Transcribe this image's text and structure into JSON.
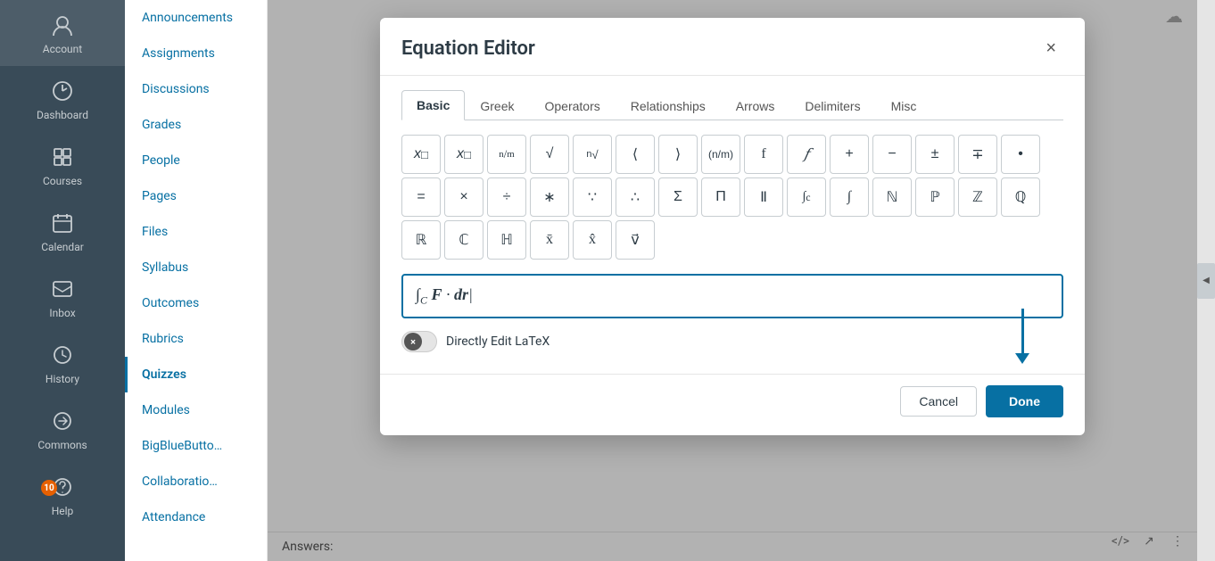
{
  "sidebar": {
    "items": [
      {
        "id": "account",
        "label": "Account",
        "icon": "👤"
      },
      {
        "id": "dashboard",
        "label": "Dashboard",
        "icon": "🏠"
      },
      {
        "id": "courses",
        "label": "Courses",
        "icon": "📋"
      },
      {
        "id": "calendar",
        "label": "Calendar",
        "icon": "📅"
      },
      {
        "id": "inbox",
        "label": "Inbox",
        "icon": "✉️"
      },
      {
        "id": "history",
        "label": "History",
        "icon": "🕐"
      },
      {
        "id": "commons",
        "label": "Commons",
        "icon": "↗️"
      },
      {
        "id": "help",
        "label": "Help",
        "icon": "❓",
        "badge": "10"
      }
    ]
  },
  "course_nav": {
    "items": [
      {
        "id": "announcements",
        "label": "Announcements"
      },
      {
        "id": "assignments",
        "label": "Assignments"
      },
      {
        "id": "discussions",
        "label": "Discussions"
      },
      {
        "id": "grades",
        "label": "Grades"
      },
      {
        "id": "people",
        "label": "People"
      },
      {
        "id": "pages",
        "label": "Pages"
      },
      {
        "id": "files",
        "label": "Files"
      },
      {
        "id": "syllabus",
        "label": "Syllabus"
      },
      {
        "id": "outcomes",
        "label": "Outcomes"
      },
      {
        "id": "rubrics",
        "label": "Rubrics"
      },
      {
        "id": "quizzes",
        "label": "Quizzes",
        "active": true
      },
      {
        "id": "modules",
        "label": "Modules"
      },
      {
        "id": "bigbluebutton",
        "label": "BigBlueButto…"
      },
      {
        "id": "collaborations",
        "label": "Collaboratio…"
      },
      {
        "id": "attendance",
        "label": "Attendance"
      }
    ]
  },
  "modal": {
    "title": "Equation Editor",
    "close_label": "×",
    "tabs": [
      {
        "id": "basic",
        "label": "Basic",
        "active": true
      },
      {
        "id": "greek",
        "label": "Greek"
      },
      {
        "id": "operators",
        "label": "Operators"
      },
      {
        "id": "relationships",
        "label": "Relationships"
      },
      {
        "id": "arrows",
        "label": "Arrows"
      },
      {
        "id": "delimiters",
        "label": "Delimiters"
      },
      {
        "id": "misc",
        "label": "Misc"
      }
    ],
    "symbols": {
      "row1": [
        "x□",
        "x□",
        "n/m",
        "√",
        "ⁿ√",
        "⟨",
        "⟩",
        "(n/m)",
        "f",
        "𝑓",
        "+",
        "−",
        "±",
        "∓",
        "•"
      ],
      "row2": [
        "=",
        "×",
        "÷",
        "∗",
        "∵",
        "∴",
        "Σ",
        "Π",
        "Ⅱ",
        "∫c",
        "∫",
        "ℕ",
        "ℙ",
        "ℤ",
        "ℚ"
      ],
      "row3": [
        "ℝ",
        "ℂ",
        "ℍ",
        "x̄",
        "x̂",
        "v⃗"
      ]
    },
    "equation_value": "∫c F · dr",
    "latex_toggle": {
      "label": "Directly Edit LaTeX",
      "toggle_x": "×"
    },
    "footer": {
      "cancel_label": "Cancel",
      "done_label": "Done"
    }
  },
  "page": {
    "answers_label": "Answers:",
    "cloud_icon": "☁",
    "toolbar_icons": [
      "</>",
      "↗",
      "⋮"
    ]
  }
}
